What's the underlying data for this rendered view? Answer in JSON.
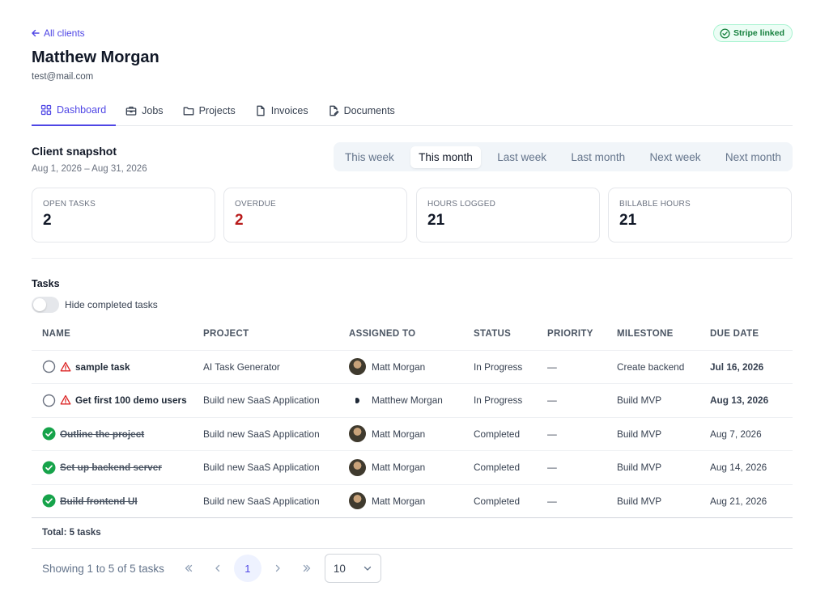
{
  "header": {
    "back_label": "All clients",
    "title": "Matthew Morgan",
    "email": "test@mail.com",
    "stripe_badge": "Stripe linked"
  },
  "tabs": [
    {
      "label": "Dashboard",
      "icon": "grid-icon",
      "active": true
    },
    {
      "label": "Jobs",
      "icon": "briefcase-icon",
      "active": false
    },
    {
      "label": "Projects",
      "icon": "folder-icon",
      "active": false
    },
    {
      "label": "Invoices",
      "icon": "file-icon",
      "active": false
    },
    {
      "label": "Documents",
      "icon": "file-edit-icon",
      "active": false
    }
  ],
  "snapshot": {
    "title": "Client snapshot",
    "range": "Aug 1, 2026 – Aug 31, 2026",
    "ranges": [
      "This week",
      "This month",
      "Last week",
      "Last month",
      "Next week",
      "Next month"
    ],
    "active_range": "This month",
    "stats": [
      {
        "label": "OPEN TASKS",
        "value": "2"
      },
      {
        "label": "OVERDUE",
        "value": "2"
      },
      {
        "label": "HOURS LOGGED",
        "value": "21"
      },
      {
        "label": "BILLABLE HOURS",
        "value": "21"
      }
    ]
  },
  "tasks": {
    "title": "Tasks",
    "toggle_label": "Hide completed tasks",
    "columns": [
      "NAME",
      "PROJECT",
      "ASSIGNED TO",
      "STATUS",
      "PRIORITY",
      "MILESTONE",
      "DUE DATE"
    ],
    "rows": [
      {
        "name": "sample task",
        "done": false,
        "project": "AI Task Generator",
        "assignee": "Matt Morgan",
        "status": "In Progress",
        "priority": "—",
        "milestone": "Create backend",
        "due": "Jul 16, 2026",
        "overdue": true
      },
      {
        "name": "Get first 100 demo users",
        "done": false,
        "project": "Build new SaaS Application",
        "assignee": "Matthew Morgan",
        "status": "In Progress",
        "priority": "—",
        "milestone": "Build MVP",
        "due": "Aug 13, 2026",
        "overdue": true
      },
      {
        "name": "Outline the project",
        "done": true,
        "project": "Build new SaaS Application",
        "assignee": "Matt Morgan",
        "status": "Completed",
        "priority": "—",
        "milestone": "Build MVP",
        "due": "Aug 7, 2026",
        "overdue": false
      },
      {
        "name": "Set up backend server",
        "done": true,
        "project": "Build new SaaS Application",
        "assignee": "Matt Morgan",
        "status": "Completed",
        "priority": "—",
        "milestone": "Build MVP",
        "due": "Aug 14, 2026",
        "overdue": false
      },
      {
        "name": "Build frontend UI",
        "done": true,
        "project": "Build new SaaS Application",
        "assignee": "Matt Morgan",
        "status": "Completed",
        "priority": "—",
        "milestone": "Build MVP",
        "due": "Aug 21, 2026",
        "overdue": false
      }
    ],
    "total": "Total: 5 tasks"
  },
  "pagination": {
    "showing": "Showing 1 to 5 of 5 tasks",
    "current_page": "1",
    "per_page": "10"
  },
  "colors": {
    "accent": "#4f46e5",
    "overdue": "#b91c1c",
    "success": "#16a34a"
  }
}
